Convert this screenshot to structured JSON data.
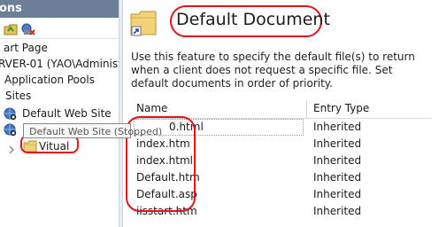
{
  "connections": {
    "title": "ons",
    "tree": {
      "start_page": "art Page",
      "server": "RVER-01 (YAO\\Administ",
      "app_pools": "Application Pools",
      "sites": "Sites",
      "default_site": "Default Web Site",
      "tooltip": "Default Web Site (Stopped)",
      "vitual": "Vitual"
    },
    "icons": [
      "folder-up-icon",
      "connect-icon"
    ]
  },
  "feature": {
    "title": "Default Document",
    "description": "Use this feature to specify the default file(s) to return when a client does not request a specific file. Set default documents in order of priority.",
    "icon": "default-document-icon"
  },
  "grid": {
    "columns": [
      "Name",
      "Entry Type"
    ],
    "rows": [
      {
        "name": "0.html",
        "entry": "Inherited"
      },
      {
        "name": "index.htm",
        "entry": "Inherited"
      },
      {
        "name": "index.html",
        "entry": "Inherited"
      },
      {
        "name": "Default.htm",
        "entry": "Inherited"
      },
      {
        "name": "Default.asp",
        "entry": "Inherited"
      },
      {
        "name": "iisstart.htm",
        "entry": "Inherited"
      }
    ]
  },
  "colors": {
    "header_bg": "#6b7f99",
    "annotation": "#e0141c"
  }
}
